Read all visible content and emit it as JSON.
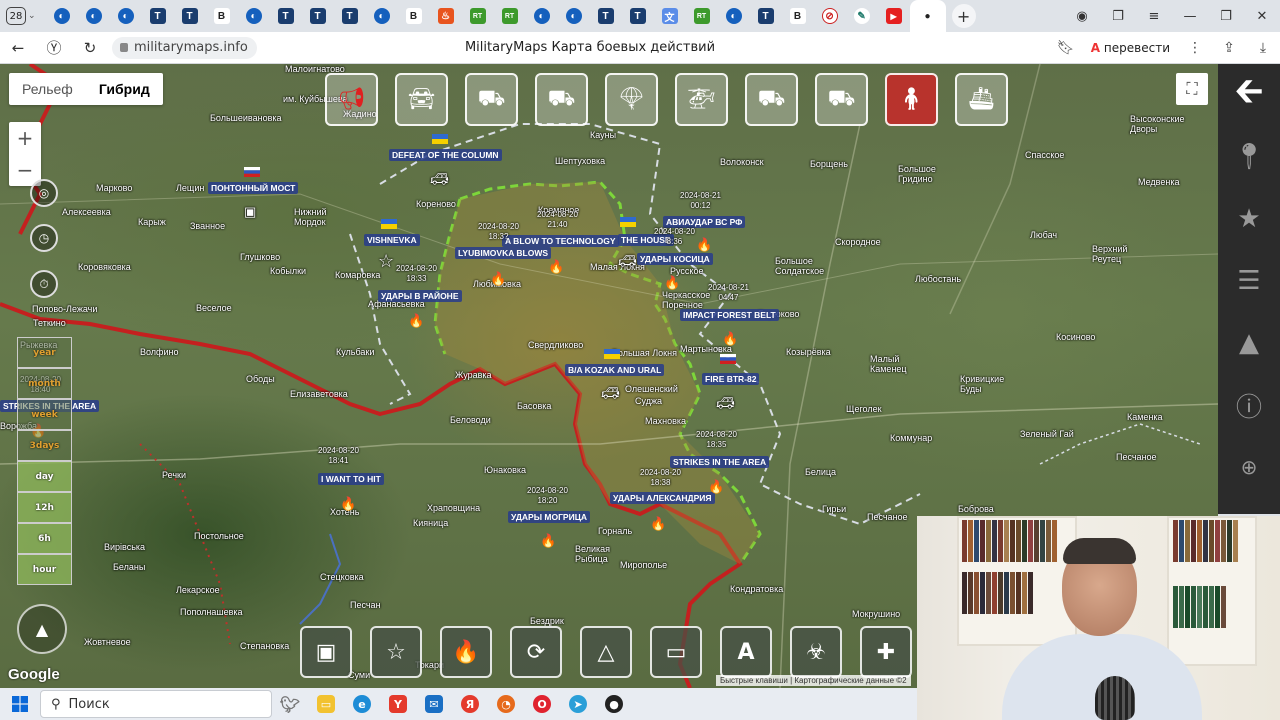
{
  "browser": {
    "tab_count": "28",
    "url": "militarymaps.info",
    "page_title": "MilitaryMaps Карта боевых действий",
    "translate_label": "перевести"
  },
  "map": {
    "type_toggle": {
      "relief": "Рельеф",
      "hybrid": "Гибрид"
    },
    "zoom_in": "+",
    "zoom_out": "−",
    "time_filters": [
      "year",
      "month",
      "week",
      "3days",
      "day",
      "12h",
      "6h",
      "hour"
    ],
    "google_logo": "Google",
    "attribution": "Быстрые клавиши  |  Картографические данные ©2",
    "place_labels": [
      {
        "id": "p1",
        "text": "Малоигнатово"
      },
      {
        "id": "p2",
        "text": "им. Куйбышева"
      },
      {
        "id": "p3",
        "text": "Большеивановка"
      },
      {
        "id": "p4",
        "text": "Жадино"
      },
      {
        "id": "p5",
        "text": "Кауны"
      },
      {
        "id": "p6",
        "text": "Шептуховка"
      },
      {
        "id": "p7",
        "text": "Волоконск"
      },
      {
        "id": "p8",
        "text": "Борщень"
      },
      {
        "id": "p9",
        "text": "Спасское"
      },
      {
        "id": "p10",
        "text": "Высоконские Дворы"
      },
      {
        "id": "p11",
        "text": "Марково"
      },
      {
        "id": "p12",
        "text": "Лещин"
      },
      {
        "id": "p13",
        "text": "Алексеевка"
      },
      {
        "id": "p14",
        "text": "Карыж"
      },
      {
        "id": "p15",
        "text": "Званное"
      },
      {
        "id": "p16",
        "text": "Нижний Мордок"
      },
      {
        "id": "p17",
        "text": "Кореново"
      },
      {
        "id": "p18",
        "text": "Кремяное"
      },
      {
        "id": "p19",
        "text": "Большое Гридино"
      },
      {
        "id": "p20",
        "text": "Медвенка"
      },
      {
        "id": "p21",
        "text": "Глушково"
      },
      {
        "id": "p22",
        "text": "Кобылки"
      },
      {
        "id": "p23",
        "text": "Коровяковка"
      },
      {
        "id": "p24",
        "text": "Комаровка"
      },
      {
        "id": "p25",
        "text": "Малая Локня"
      },
      {
        "id": "p26",
        "text": "Русское"
      },
      {
        "id": "p27",
        "text": "Скородное"
      },
      {
        "id": "p28",
        "text": "Большое Солдатское"
      },
      {
        "id": "p29",
        "text": "Любач"
      },
      {
        "id": "p30",
        "text": "Верхний Реутец"
      },
      {
        "id": "p31",
        "text": "Любостань"
      },
      {
        "id": "p32",
        "text": "Веселое"
      },
      {
        "id": "p33",
        "text": "Афанасьевка"
      },
      {
        "id": "p34",
        "text": "Любимовка"
      },
      {
        "id": "p35",
        "text": "Черкасское Поречное"
      },
      {
        "id": "p36",
        "text": "Бирюково"
      },
      {
        "id": "p37",
        "text": "Попово-Лежачи"
      },
      {
        "id": "p38",
        "text": "Теткино"
      },
      {
        "id": "p39",
        "text": "Рыжевка"
      },
      {
        "id": "p40",
        "text": "Волфино"
      },
      {
        "id": "p41",
        "text": "Кульбаки"
      },
      {
        "id": "p42",
        "text": "Свердликово"
      },
      {
        "id": "p43",
        "text": "Большая Локня"
      },
      {
        "id": "p44",
        "text": "Мартыновка"
      },
      {
        "id": "p45",
        "text": "Козырёвка"
      },
      {
        "id": "p46",
        "text": "Косиново"
      },
      {
        "id": "p47",
        "text": "Малый Каменец"
      },
      {
        "id": "p48",
        "text": "Кривицкие Буды"
      },
      {
        "id": "p49",
        "text": "Ободы"
      },
      {
        "id": "p50",
        "text": "Журавка"
      },
      {
        "id": "p51",
        "text": "Олешенский"
      },
      {
        "id": "p52",
        "text": "Суджа"
      },
      {
        "id": "p53",
        "text": "Елизаветовка"
      },
      {
        "id": "p54",
        "text": "Басовка"
      },
      {
        "id": "p55",
        "text": "Щеголек"
      },
      {
        "id": "p56",
        "text": "Каменка"
      },
      {
        "id": "p57",
        "text": "Ворожба"
      },
      {
        "id": "p58",
        "text": "Беловоди"
      },
      {
        "id": "p59",
        "text": "Махновка"
      },
      {
        "id": "p60",
        "text": "Коммунар"
      },
      {
        "id": "p61",
        "text": "Зеленый Гай"
      },
      {
        "id": "p62",
        "text": "Песчаное"
      },
      {
        "id": "p63",
        "text": "Юнаковка"
      },
      {
        "id": "p64",
        "text": "Белица"
      },
      {
        "id": "p65",
        "text": "Речки"
      },
      {
        "id": "p66",
        "text": "Хотень"
      },
      {
        "id": "p67",
        "text": "Храповщина"
      },
      {
        "id": "p68",
        "text": "Кияница"
      },
      {
        "id": "p69",
        "text": "Гирьи"
      },
      {
        "id": "p70",
        "text": "Боброва"
      },
      {
        "id": "p71",
        "text": "Песчаное"
      },
      {
        "id": "p72",
        "text": "Мирополье"
      },
      {
        "id": "p73",
        "text": "Великая Рыбица"
      },
      {
        "id": "p74",
        "text": "Вирівська"
      },
      {
        "id": "p75",
        "text": "Беланы"
      },
      {
        "id": "p76",
        "text": "Постольное"
      },
      {
        "id": "p77",
        "text": "Стецковка"
      },
      {
        "id": "p78",
        "text": "Кондратовка"
      },
      {
        "id": "p79",
        "text": "Лекарское"
      },
      {
        "id": "p80",
        "text": "Пополнашевка"
      },
      {
        "id": "p81",
        "text": "Песчан"
      },
      {
        "id": "p82",
        "text": "Бездрик"
      },
      {
        "id": "p83",
        "text": "Мокрушино"
      },
      {
        "id": "p84",
        "text": "Жовтневое"
      },
      {
        "id": "p85",
        "text": "Степановка"
      },
      {
        "id": "p86",
        "text": "Суми"
      },
      {
        "id": "p87",
        "text": "Токари"
      },
      {
        "id": "p88",
        "text": "Горналь"
      }
    ],
    "annotations": [
      {
        "id": "a1",
        "text": "DEFEAT OF THE COLUMN"
      },
      {
        "id": "a2",
        "text": "ПОНТОННЫЙ МОСТ"
      },
      {
        "id": "a3",
        "text": "VISHNEVKA"
      },
      {
        "id": "a4",
        "text": "A BLOW TO TECHNOLOGY"
      },
      {
        "id": "a5",
        "text": "THE HOUSE"
      },
      {
        "id": "a6",
        "text": "АВИАУДАР ВС РФ"
      },
      {
        "id": "a7",
        "text": "LYUBIMOVKA BLOWS"
      },
      {
        "id": "a8",
        "text": "УДАРЫ КОСИЦА"
      },
      {
        "id": "a9",
        "text": "УДАРЫ В РАЙОНЕ"
      },
      {
        "id": "a10",
        "text": "IMPACT FOREST BELT"
      },
      {
        "id": "a11",
        "text": "B/A KOZAK AND URAL"
      },
      {
        "id": "a12",
        "text": "FIRE BTR-82"
      },
      {
        "id": "a13",
        "text": "STRIKES IN THE AREA"
      },
      {
        "id": "a14",
        "text": "STRIKES IN THE AREA"
      },
      {
        "id": "a15",
        "text": "I WANT TO HIT"
      },
      {
        "id": "a16",
        "text": "УДАРЫ АЛЕКСАНДРИЯ"
      },
      {
        "id": "a17",
        "text": "УДАРЫ МОГРИЦА"
      }
    ],
    "timestamps": [
      {
        "id": "t1",
        "text": "2024-08-21\n00:12"
      },
      {
        "id": "t2",
        "text": "2024-08-20\n21:40"
      },
      {
        "id": "t3",
        "text": "2024-08-20\n18:3?"
      },
      {
        "id": "t4",
        "text": "2024-08-20\n8:36"
      },
      {
        "id": "t5",
        "text": "2024-08-20\n18:33"
      },
      {
        "id": "t6",
        "text": "2024-08-21\n04:47"
      },
      {
        "id": "t7",
        "text": "2024-08-20\n18:40"
      },
      {
        "id": "t8",
        "text": "2024-08-20\n18:41"
      },
      {
        "id": "t9",
        "text": "2024-08-20\n18:35"
      },
      {
        "id": "t10",
        "text": "2024-08-20\n18:38"
      },
      {
        "id": "t11",
        "text": "2024-08-20\n18:20"
      }
    ]
  },
  "taskbar": {
    "search_placeholder": "Поиск"
  },
  "colors": {
    "front_red": "#c4201f",
    "front_green": "#7dd63a",
    "front_white": "#d8dde4",
    "sidebar_bg": "#2b2b2b"
  }
}
